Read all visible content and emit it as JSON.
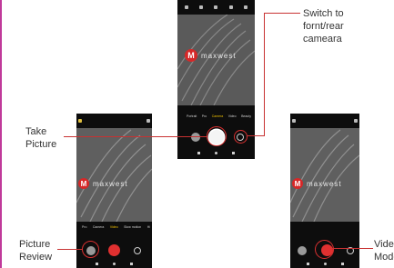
{
  "colors": {
    "border": "#c0399a",
    "leader": "#c83232",
    "mode_active": "#f2c200",
    "logo_red": "#d62828"
  },
  "phones": [
    {
      "brand": "maxwest",
      "logo_letter": "M",
      "modes": [
        "Portrait",
        "Pro",
        "Camera",
        "Video",
        "Beauty"
      ],
      "active_mode": 2
    },
    {
      "brand": "maxwest",
      "logo_letter": "M",
      "modes": [
        "Pro",
        "Camera",
        "Video",
        "Slow motion",
        "Hi"
      ],
      "active_mode": 2
    },
    {
      "brand": "maxwest",
      "logo_letter": "M"
    }
  ],
  "labels": {
    "switch": "Switch to\nfornt/rear\ncameara",
    "take": "Take\nPicture",
    "review": "Picture\nReview",
    "video": "Video\nMode"
  }
}
